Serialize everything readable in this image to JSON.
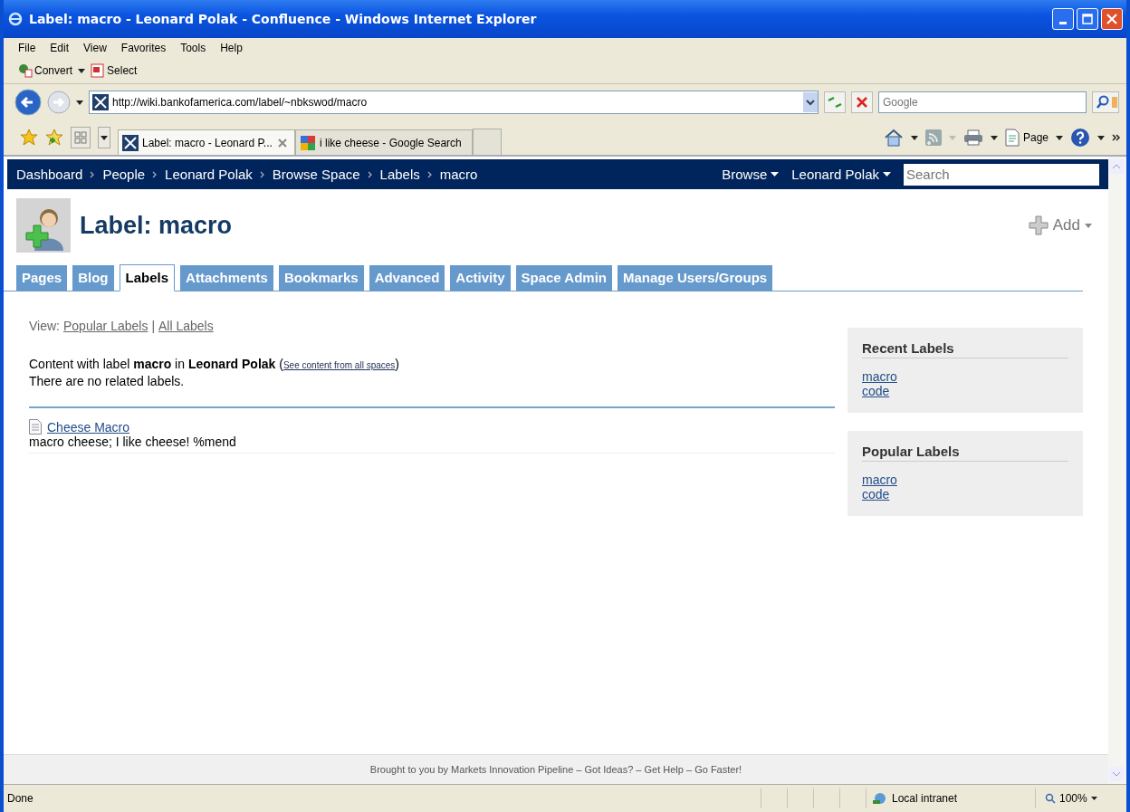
{
  "window": {
    "title": "Label: macro - Leonard Polak - Confluence - Windows Internet Explorer"
  },
  "menu": [
    "File",
    "Edit",
    "View",
    "Favorites",
    "Tools",
    "Help"
  ],
  "command_bar": [
    {
      "label": "Convert",
      "kind": "convert",
      "dropdown": true
    },
    {
      "label": "Select",
      "kind": "select",
      "dropdown": false
    }
  ],
  "address": {
    "value": "http://wiki.bankofamerica.com/label/~nbkswod/macro"
  },
  "search": {
    "placeholder": "Google"
  },
  "browser_tabs": [
    {
      "label": "Label: macro - Leonard P...",
      "kind": "confluence",
      "selected": true
    },
    {
      "label": "i like cheese - Google Search",
      "kind": "google",
      "selected": false
    }
  ],
  "tools": [
    {
      "label": "Page",
      "kind": "page"
    }
  ],
  "nav": {
    "breadcrumbs": [
      "Dashboard",
      "People",
      "Leonard Polak",
      "Browse Space",
      "Labels",
      "macro"
    ],
    "menus": [
      "Browse",
      "Leonard Polak"
    ],
    "search": {
      "placeholder": "Search"
    }
  },
  "page": {
    "title": "Label: macro",
    "add": "Add",
    "tabs": [
      {
        "label": "Pages",
        "selected": false
      },
      {
        "label": "Blog",
        "selected": false
      },
      {
        "label": "Labels",
        "selected": true
      },
      {
        "label": "Attachments",
        "selected": false
      },
      {
        "label": "Bookmarks",
        "selected": false
      },
      {
        "label": "Advanced",
        "selected": false
      },
      {
        "label": "Activity",
        "selected": false
      },
      {
        "label": "Space Admin",
        "selected": false
      },
      {
        "label": "Manage Users/Groups",
        "selected": false
      }
    ],
    "view": {
      "prefix": "View:",
      "links": [
        "Popular Labels",
        "All Labels"
      ],
      "separator": "|"
    },
    "content": {
      "before": "Content with label **macro** in **Leonard Polak** (",
      "link": "See content from all spaces",
      "after": ")"
    },
    "related": "There are no related labels.",
    "results": [
      {
        "title": "Cheese Macro",
        "excerpt": "macro cheese; I like cheese! %mend"
      }
    ],
    "sidebar": [
      {
        "heading": "Recent Labels",
        "links": [
          "macro",
          "code"
        ]
      },
      {
        "heading": "Popular Labels",
        "links": [
          "macro",
          "code"
        ]
      }
    ],
    "footer": "Brought to you by Markets Innovation Pipeline – Got Ideas? – Get Help – Go Faster!"
  },
  "status_bar": {
    "text": "Done",
    "zone": "Local intranet",
    "zoom": "100%"
  }
}
